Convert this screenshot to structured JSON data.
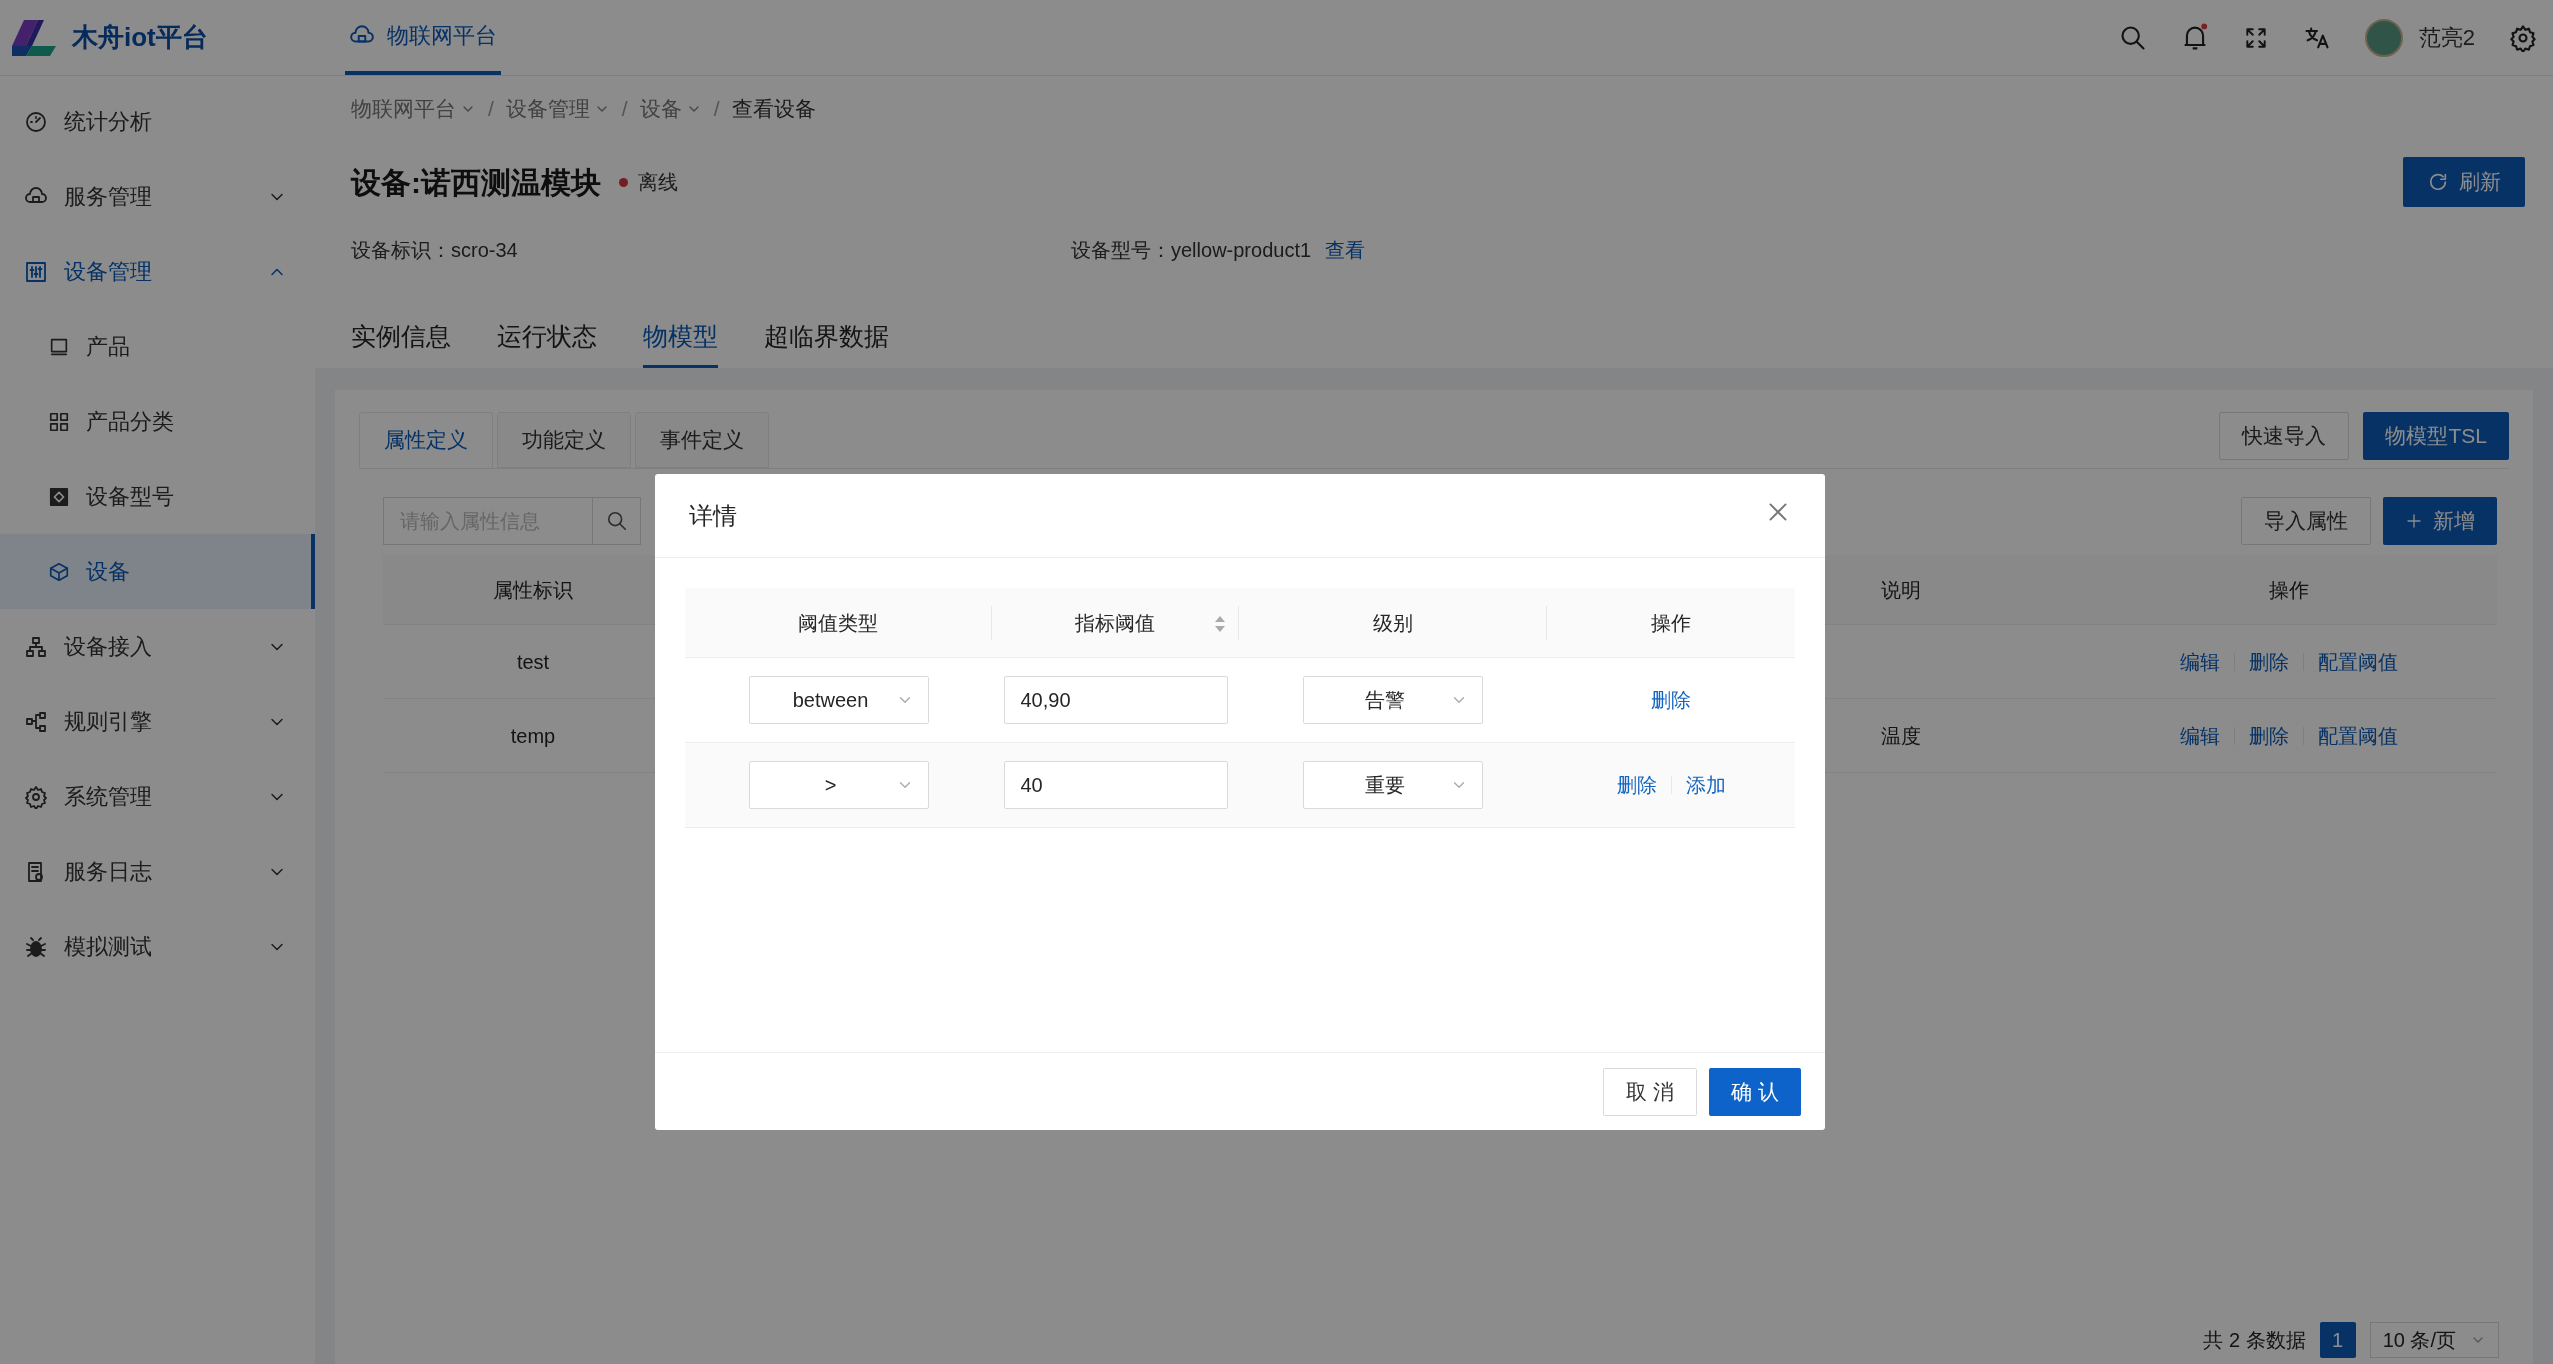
{
  "header": {
    "logo_text": "木舟iot平台",
    "nav_tabs": [
      {
        "label": "物联网平台",
        "selected": true
      }
    ],
    "user_name": "范亮2"
  },
  "sidebar": {
    "items": [
      {
        "label": "统计分析",
        "kind": "link",
        "selected": false
      },
      {
        "label": "服务管理",
        "kind": "group",
        "selected": false,
        "expanded": false
      },
      {
        "label": "设备管理",
        "kind": "group",
        "selected": true,
        "expanded": true,
        "children": [
          {
            "label": "产品",
            "selected": false
          },
          {
            "label": "产品分类",
            "selected": false
          },
          {
            "label": "设备型号",
            "selected": false
          },
          {
            "label": "设备",
            "selected": true
          }
        ]
      },
      {
        "label": "设备接入",
        "kind": "group",
        "selected": false,
        "expanded": false
      },
      {
        "label": "规则引擎",
        "kind": "group",
        "selected": false,
        "expanded": false
      },
      {
        "label": "系统管理",
        "kind": "group",
        "selected": false,
        "expanded": false
      },
      {
        "label": "服务日志",
        "kind": "group",
        "selected": false,
        "expanded": false
      },
      {
        "label": "模拟测试",
        "kind": "group",
        "selected": false,
        "expanded": false
      }
    ]
  },
  "breadcrumb": [
    {
      "label": "物联网平台",
      "dropdown": true
    },
    {
      "separator": "/",
      "label": "设备管理",
      "dropdown": true
    },
    {
      "separator": "/",
      "label": "设备",
      "dropdown": true
    },
    {
      "separator": "/",
      "label": "查看设备",
      "dropdown": false
    }
  ],
  "device": {
    "title": "设备:诺西测温模块",
    "status": "离线",
    "refresh_button": "刷新",
    "id_label": "设备标识：",
    "id_value": "scro-34",
    "model_label": "设备型号：",
    "model_value": "yellow-product1",
    "model_link": "查看"
  },
  "tabs": [
    {
      "label": "实例信息",
      "selected": false
    },
    {
      "label": "运行状态",
      "selected": false
    },
    {
      "label": "物模型",
      "selected": true
    },
    {
      "label": "超临界数据",
      "selected": false
    }
  ],
  "subtabs": [
    {
      "label": "属性定义",
      "selected": true
    },
    {
      "label": "功能定义",
      "selected": false
    },
    {
      "label": "事件定义",
      "selected": false
    }
  ],
  "toolbar_buttons": [
    {
      "label": "快速导入",
      "primary": false
    },
    {
      "label": "物模型TSL",
      "primary": true
    }
  ],
  "search": {
    "placeholder": "请输入属性信息"
  },
  "list_buttons": [
    {
      "label": "导入属性",
      "primary": false
    },
    {
      "label": "新增",
      "primary": true
    }
  ],
  "table": {
    "columns": [
      "属性标识",
      "说明",
      "操作"
    ],
    "rows": [
      {
        "id": "test",
        "actions": [
          "编辑",
          "删除",
          "配置阈值"
        ]
      },
      {
        "id": "temp",
        "note": "温度",
        "actions": [
          "编辑",
          "删除",
          "配置阈值"
        ]
      }
    ]
  },
  "pagination": {
    "total": "共 2 条数据",
    "pages": [
      {
        "label": "1",
        "selected": true
      }
    ],
    "page_size": "10 条/页"
  },
  "dialog": {
    "title": "详情",
    "columns": [
      {
        "label": "阈值类型",
        "sortable": false
      },
      {
        "label": "指标阈值",
        "sortable": true
      },
      {
        "label": "级别",
        "sortable": false
      },
      {
        "label": "操作",
        "sortable": false
      }
    ],
    "rows": [
      {
        "type": "between",
        "value": "40,90",
        "level_name": "告警",
        "actions": [
          "删除"
        ]
      },
      {
        "type": ">",
        "value": "40",
        "level_name": "重要",
        "actions": [
          "删除",
          "添加"
        ]
      }
    ],
    "cancel": "取 消",
    "confirm": "确 认"
  }
}
